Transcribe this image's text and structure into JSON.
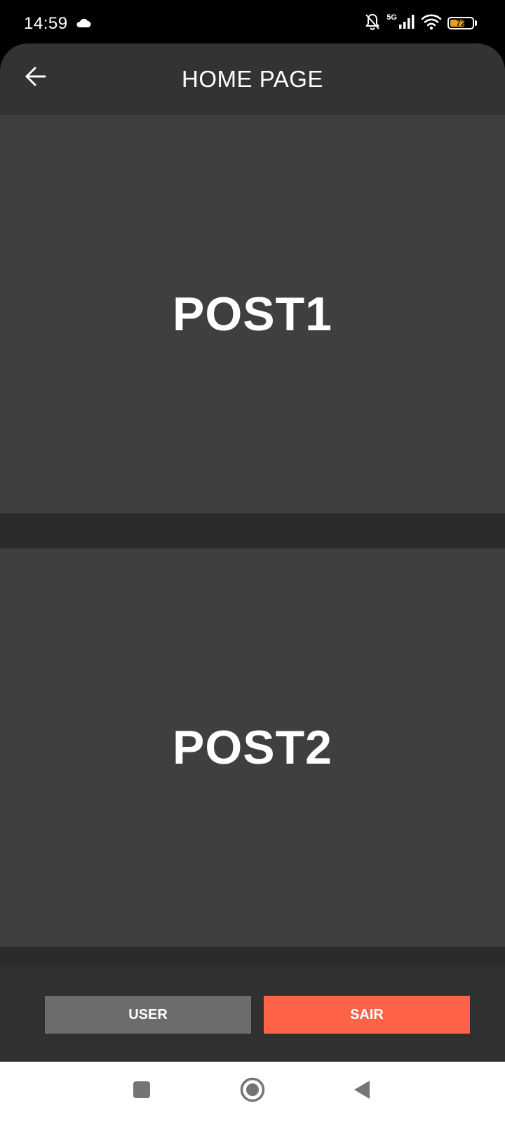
{
  "status_bar": {
    "time": "14:59",
    "network": "5G",
    "battery": "72",
    "battery_level": 0.72
  },
  "header": {
    "title": "HOME PAGE",
    "back_icon": "arrow-left-icon"
  },
  "posts": [
    {
      "label": "POST1"
    },
    {
      "label": "POST2"
    }
  ],
  "actions": {
    "user_label": "USER",
    "sair_label": "SAIR"
  },
  "colors": {
    "background": "#2b2b2b",
    "header": "#333333",
    "post": "#3f3f3f",
    "user_button": "#6c6c6c",
    "sair_button": "#ff6347",
    "battery_fill": "#e6a020"
  },
  "navigation": {
    "icons": [
      "recents-square-icon",
      "home-circle-icon",
      "back-triangle-icon"
    ]
  }
}
